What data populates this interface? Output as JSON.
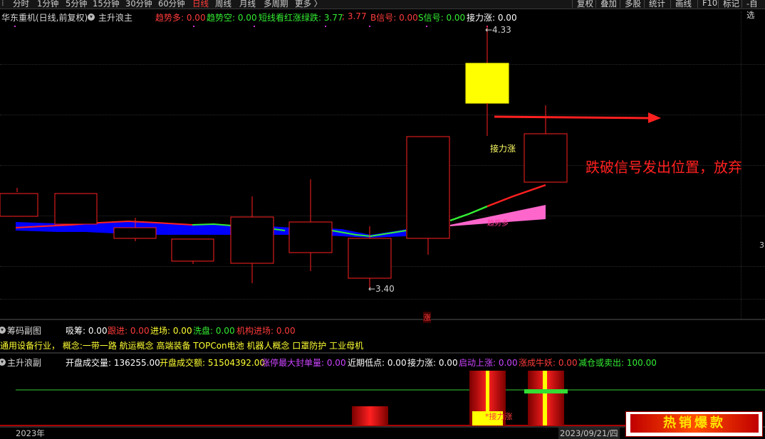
{
  "toolbar": {
    "periods": [
      "分时",
      "1分钟",
      "5分钟",
      "15分钟",
      "30分钟",
      "60分钟",
      "日线",
      "周线",
      "月线",
      "多周期",
      "更多 〉"
    ],
    "active_period": "日线",
    "right_buttons": [
      "复权",
      "叠加",
      "多股",
      "统计",
      "画线",
      "F10",
      "标记",
      "-自选"
    ]
  },
  "main": {
    "stock_title": "华东重机(日线,前复权)",
    "indicator_name": "主升浪主",
    "indicators": [
      {
        "label": "趋势多: 0.00",
        "color": "#ff3b3b"
      },
      {
        "label": "趋势空: 0.00",
        "color": "#33ee33"
      },
      {
        "label": "短线看红涨绿跌: 3.77",
        "color": "#33ee33"
      },
      {
        "label": "; 3.77",
        "color": "#ff3b3b"
      },
      {
        "label": "B信号: 0.00",
        "color": "#ff3b3b"
      },
      {
        "label": "S信号: 0.00",
        "color": "#33ee33"
      },
      {
        "label": "接力涨: 0.00",
        "color": "#ffffff"
      }
    ],
    "high_label": "←4.33",
    "low_label": "←3.40",
    "relay_label": "接力涨",
    "trend_label": "趋势多",
    "annotation": "跌破信号发出位置，放弃",
    "zhang_marker": "涨",
    "right_edge_label": "3"
  },
  "chip": {
    "title": "筹码副图",
    "indicators": [
      {
        "label": "吸筹: 0.00",
        "color": "#ffffff"
      },
      {
        "label": "跟进: 0.00",
        "color": "#ff3b3b"
      },
      {
        "label": "进场: 0.00",
        "color": "#ffff33"
      },
      {
        "label": "洗盘: 0.00",
        "color": "#33ee33"
      },
      {
        "label": "机构进场: 0.00",
        "color": "#ff3b3b"
      }
    ],
    "concepts": "通用设备行业， 概念:一带一路 航运概念 高端装备 TOPCon电池 机器人概念 口罩防护 工业母机"
  },
  "sub": {
    "title": "主升浪副",
    "indicators": [
      {
        "label": "开盘成交量: 136255.00",
        "color": "#ffffff"
      },
      {
        "label": "开盘成交额: 51504392.00",
        "color": "#ffff33"
      },
      {
        "label": "涨停最大封单量: 0.00",
        "color": "#cc44ff"
      },
      {
        "label": "近期低点: 0.00",
        "color": "#ffffff"
      },
      {
        "label": "接力涨: 0.00",
        "color": "#ffffff"
      },
      {
        "label": "启动上涨: 0.00",
        "color": "#cc44ff"
      },
      {
        "label": "涨成牛妖: 0.00",
        "color": "#ff3b3b"
      },
      {
        "label": "减仓或卖出: 100.00",
        "color": "#33ee33"
      }
    ],
    "relay_text": "*接力涨"
  },
  "footer": {
    "year": "2023年",
    "date": "2023/09/21/四"
  },
  "ad": {
    "text": "热销爆款"
  },
  "colors": {
    "up": "#ff2020",
    "yellow_candle": "#ffff00",
    "band": "#0000ff",
    "line_green": "#33ee33",
    "line_red": "#ff2020",
    "pink": "#ff66cc"
  }
}
